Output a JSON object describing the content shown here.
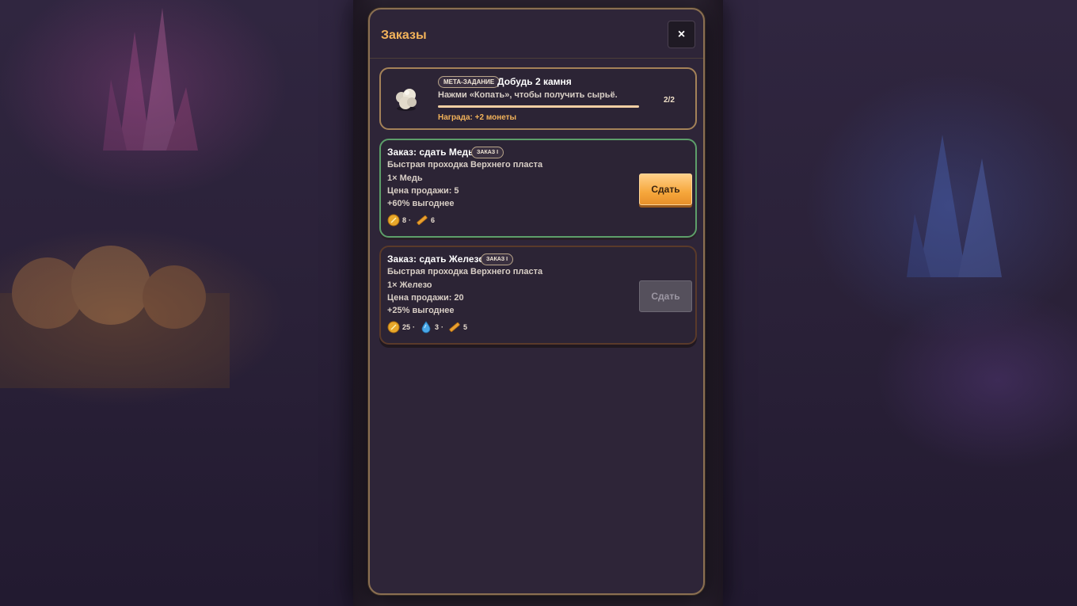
{
  "modal": {
    "title": "Заказы",
    "close_label": "×"
  },
  "meta_task": {
    "badge": "МЕТА-ЗАДАНИЕ",
    "title": "Добудь 2 камня",
    "description": "Нажми «Копать», чтобы получить сырьё.",
    "progress_text": "2/2",
    "progress_fraction": 1.0,
    "reward": "Награда: +2 монеты",
    "icon": "stone-icon"
  },
  "orders": [
    {
      "title": "Заказ: сдать Медь",
      "badge": "ЗАКАЗ I",
      "subtitle": "Быстрая проходка Верхнего пласта",
      "quantity": "1× Медь",
      "price": "Цена продажи: 5",
      "bonus": "+60% выгоднее",
      "rewards": [
        {
          "icon": "coin-icon",
          "value": "8",
          "sep": "·"
        },
        {
          "icon": "plank-icon",
          "value": "6",
          "sep": ""
        }
      ],
      "button_label": "Сдать",
      "enabled": true
    },
    {
      "title": "Заказ: сдать Железо",
      "badge": "ЗАКАЗ I",
      "subtitle": "Быстрая проходка Верхнего пласта",
      "quantity": "1× Железо",
      "price": "Цена продажи: 20",
      "bonus": "+25% выгоднее",
      "rewards": [
        {
          "icon": "coin-icon",
          "value": "25",
          "sep": "·"
        },
        {
          "icon": "crystal-icon",
          "value": "3",
          "sep": "·"
        },
        {
          "icon": "plank-icon",
          "value": "5",
          "sep": ""
        }
      ],
      "button_label": "Сдать",
      "enabled": false
    }
  ],
  "colors": {
    "accent": "#f3b35a",
    "panel": "#2e2538",
    "active_border": "#5d9f6a",
    "button": "#f6a73c"
  }
}
